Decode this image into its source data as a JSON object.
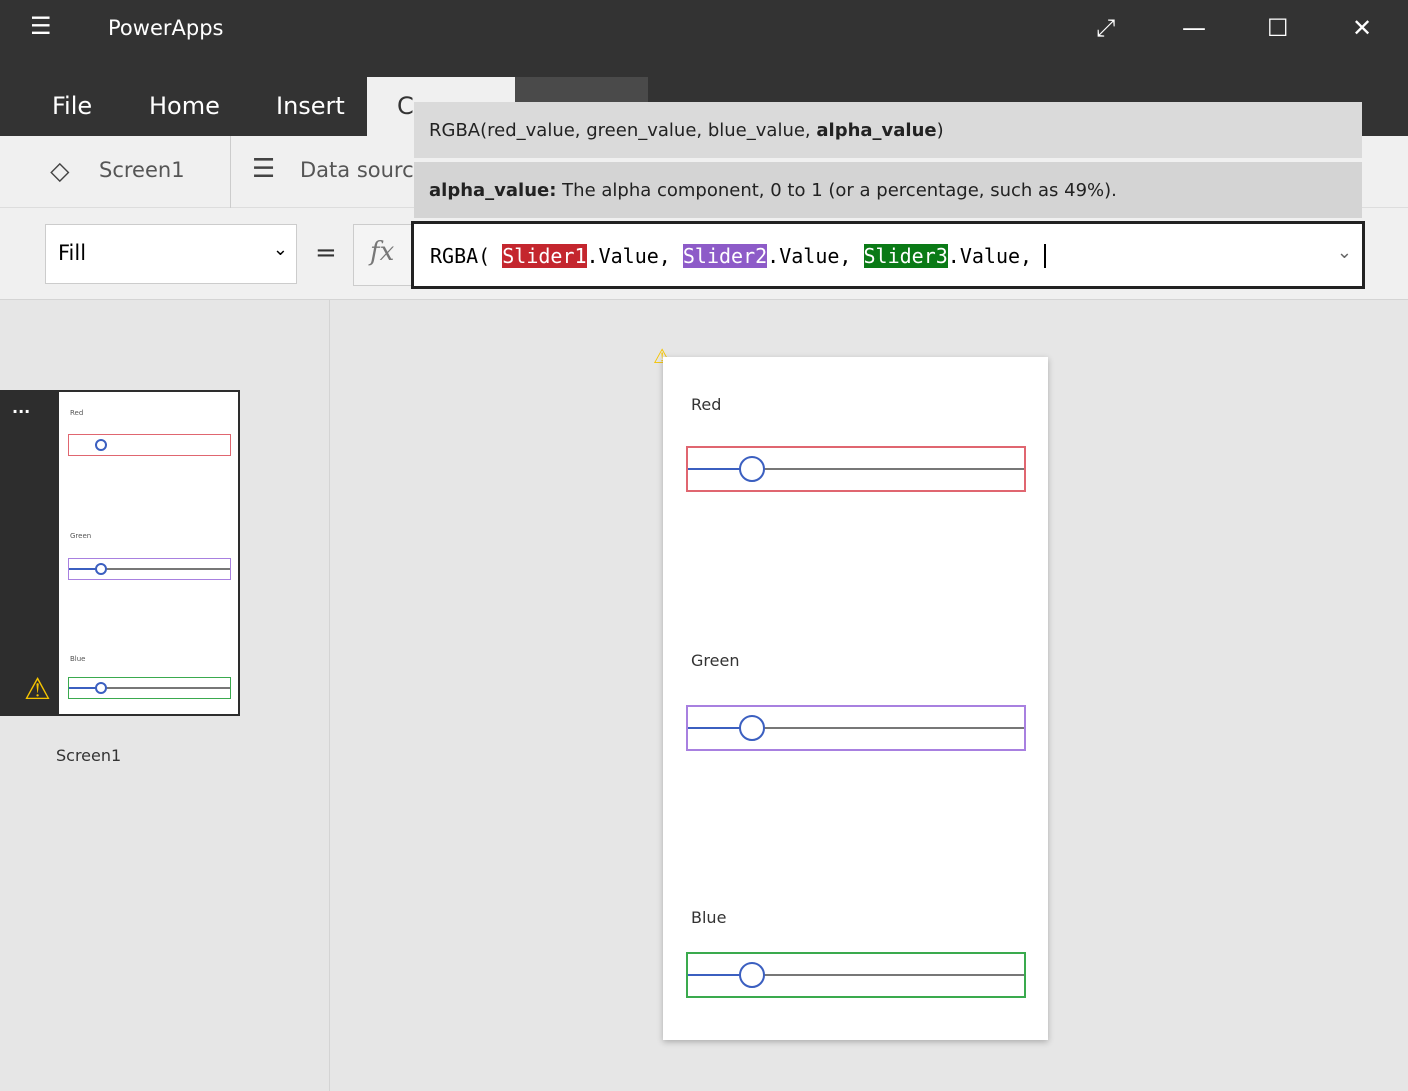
{
  "window": {
    "title": "PowerApps",
    "menu_icon": "hamburger-icon",
    "controls": [
      "expand-icon",
      "minimize-icon",
      "maximize-icon",
      "close-icon"
    ]
  },
  "tabs": [
    {
      "label": "File"
    },
    {
      "label": "Home"
    },
    {
      "label": "Insert"
    },
    {
      "label": "C"
    }
  ],
  "ribbon": {
    "screen_label": "Screen1",
    "data_sources_label": "Data source"
  },
  "formula_bar": {
    "property": "Fill",
    "equals": "=",
    "fx": "fx",
    "prefix": "RGBA( ",
    "s1": "Slider1",
    "t1": ".Value, ",
    "s2": "Slider2",
    "t2": ".Value, ",
    "s3": "Slider3",
    "t3": ".Value, "
  },
  "tooltip": {
    "signature_prefix": "RGBA(red_value, green_value, blue_value, ",
    "signature_bold": "alpha_value",
    "signature_suffix": ")",
    "param_name": "alpha_value:",
    "param_desc": " The alpha component, 0 to 1 (or a percentage, such as 49%)."
  },
  "colors": {
    "red": "#c4262e",
    "purple": "#8d5bc8",
    "green": "#0a7a16",
    "red_border": "#e06670",
    "purple_border": "#a880e0",
    "green_border": "#3aaa4e"
  },
  "thumbnail": {
    "more": "...",
    "label": "Screen1",
    "labels": [
      "Red",
      "Green",
      "Blue"
    ]
  },
  "canvas": {
    "sliders": [
      {
        "label": "Red",
        "value_percent": 19
      },
      {
        "label": "Green",
        "value_percent": 19
      },
      {
        "label": "Blue",
        "value_percent": 19
      }
    ]
  }
}
